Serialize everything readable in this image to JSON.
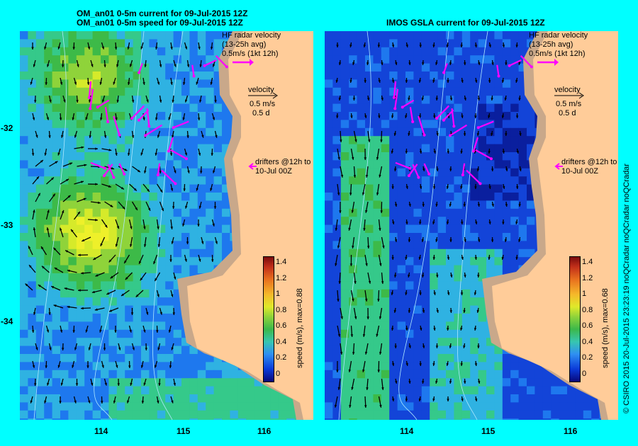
{
  "left_panel": {
    "title_line1": "OM_an01 0-5m current for 09-Jul-2015 12Z",
    "title_line2": "OM_an01 0-5m speed for 09-Jul-2015 12Z"
  },
  "right_panel": {
    "title_line1": "IMOS GSLA current for 09-Jul-2015 12Z"
  },
  "legend": {
    "hf_line1": "HF radar velocity",
    "hf_line2": "(13-25h avg)",
    "hf_line3": "0.5m/s (1kt 12h)",
    "vel_label": "velocity",
    "vel_speed": "0.5 m/s",
    "vel_time": "0.5 d",
    "drifter_line1": "drifters @12h to",
    "drifter_line2": "10-Jul 00Z"
  },
  "axes": {
    "lat_ticks": [
      "-32",
      "-33",
      "-34"
    ],
    "lon_ticks": [
      "114",
      "115",
      "116"
    ]
  },
  "colorbar": {
    "title": "speed (m/s), max=0.88",
    "title_right": "speed (m/s), max=0.68",
    "labels": [
      "1.4",
      "1.2",
      "1",
      "0.8",
      "0.6",
      "0.4",
      "0.2",
      "0"
    ]
  },
  "credit": "© CSIRO 2015   20-Jul-2015 23:23:19 noQCradar noQCradar noQCradar",
  "colors": {
    "background": "#00ffff",
    "land": "#ffcc99",
    "shelf": "#c9a88a",
    "hf_radar_arrow": "#ff00ff",
    "model_arrow": "#000000"
  }
}
